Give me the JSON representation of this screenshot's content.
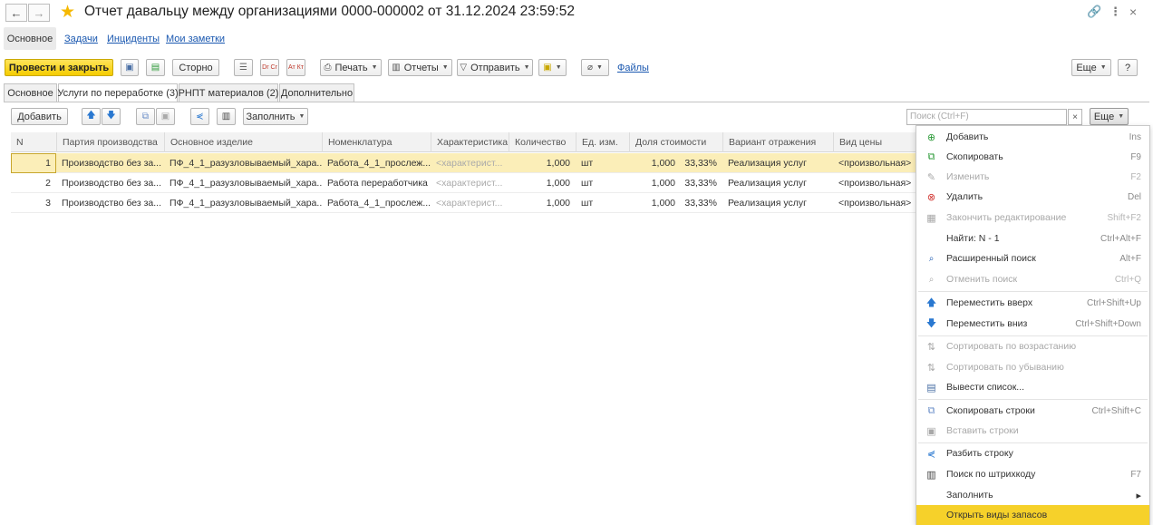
{
  "window": {
    "title": "Отчет давальцу между организациями 0000-000002 от 31.12.2024 23:59:52",
    "back_glyph": "←",
    "forward_glyph": "→",
    "link_glyph": "🔗",
    "more_glyph": "⋮",
    "close_glyph": "×"
  },
  "sections": {
    "active": "Основное",
    "links": [
      "Задачи",
      "Инциденты",
      "Мои заметки"
    ]
  },
  "toolbar": {
    "post_close": "Провести и закрыть",
    "storno": "Сторно",
    "dt_kt": "Dr Cr",
    "at_kt": "Ат Кт",
    "print": "Печать",
    "reports": "Отчеты",
    "send": "Отправить",
    "files": "Файлы",
    "more": "Еще",
    "help": "?"
  },
  "tabs": [
    "Основное",
    "Услуги по переработке (3)",
    "РНПТ материалов (2)",
    "Дополнительно"
  ],
  "table_toolbar": {
    "add": "Добавить",
    "fill": "Заполнить",
    "search_placeholder": "Поиск (Ctrl+F)",
    "search_clear": "×",
    "more": "Еще"
  },
  "table": {
    "columns": [
      "N",
      "Партия производства",
      "Основное изделие",
      "Номенклатура",
      "Характеристика",
      "Количество",
      "Ед. изм.",
      "Доля стоимости",
      "Вариант отражения",
      "Вид цены"
    ],
    "rows": [
      [
        "1",
        "Производство без за...",
        "ПФ_4_1_разузловываемый_хара...",
        "Работа_4_1_прослеж...",
        "<характерист...",
        "1,000",
        "шт",
        "1,000",
        "33,33%",
        "Реализация услуг",
        "<произвольная>"
      ],
      [
        "2",
        "Производство без за...",
        "ПФ_4_1_разузловываемый_хара...",
        "Работа переработчика",
        "<характерист...",
        "1,000",
        "шт",
        "1,000",
        "33,33%",
        "Реализация услуг",
        "<произвольная>"
      ],
      [
        "3",
        "Производство без за...",
        "ПФ_4_1_разузловываемый_хара...",
        "Работа_4_1_прослеж...",
        "<характерист...",
        "1,000",
        "шт",
        "1,000",
        "33,33%",
        "Реализация услуг",
        "<произвольная>"
      ]
    ]
  },
  "menu": {
    "items": [
      {
        "label": "Добавить",
        "shortcut": "Ins",
        "icon": "add-icon",
        "glyph": "⊕",
        "color": "#2e9b3a",
        "disabled": false
      },
      {
        "label": "Скопировать",
        "shortcut": "F9",
        "icon": "copy-icon",
        "glyph": "⧉",
        "color": "#2e9b3a",
        "disabled": false
      },
      {
        "label": "Изменить",
        "shortcut": "F2",
        "icon": "pencil-icon",
        "glyph": "✎",
        "color": "#999",
        "disabled": true
      },
      {
        "label": "Удалить",
        "shortcut": "Del",
        "icon": "delete-icon",
        "glyph": "⊗",
        "color": "#d0312d",
        "disabled": false
      },
      {
        "label": "Закончить редактирование",
        "shortcut": "Shift+F2",
        "icon": "end-edit-icon",
        "glyph": "▦",
        "color": "#aaa",
        "disabled": true
      },
      {
        "label": "Найти: N - 1",
        "shortcut": "Ctrl+Alt+F",
        "icon": "",
        "glyph": "",
        "color": "#333",
        "disabled": false
      },
      {
        "label": "Расширенный поиск",
        "shortcut": "Alt+F",
        "icon": "advanced-search-icon",
        "glyph": "🔍",
        "color": "#1a58b0",
        "disabled": false
      },
      {
        "label": "Отменить поиск",
        "shortcut": "Ctrl+Q",
        "icon": "cancel-search-icon",
        "glyph": "🔍",
        "color": "#aaa",
        "disabled": true
      },
      {
        "label": "Переместить вверх",
        "shortcut": "Ctrl+Shift+Up",
        "icon": "arrow-up-icon",
        "glyph": "🡅",
        "color": "#2a78d0",
        "disabled": false
      },
      {
        "label": "Переместить вниз",
        "shortcut": "Ctrl+Shift+Down",
        "icon": "arrow-down-icon",
        "glyph": "🡇",
        "color": "#2a78d0",
        "disabled": false
      },
      {
        "label": "Сортировать по возрастанию",
        "shortcut": "",
        "icon": "sort-asc-icon",
        "glyph": "⇅",
        "color": "#aaa",
        "disabled": true
      },
      {
        "label": "Сортировать по убыванию",
        "shortcut": "",
        "icon": "sort-desc-icon",
        "glyph": "⇅",
        "color": "#aaa",
        "disabled": true
      },
      {
        "label": "Вывести список...",
        "shortcut": "",
        "icon": "output-list-icon",
        "glyph": "▤",
        "color": "#4a6fa5",
        "disabled": false
      },
      {
        "label": "Скопировать строки",
        "shortcut": "Ctrl+Shift+C",
        "icon": "copy-rows-icon",
        "glyph": "⧉",
        "color": "#6b8fc9",
        "disabled": false
      },
      {
        "label": "Вставить строки",
        "shortcut": "",
        "icon": "paste-rows-icon",
        "glyph": "▣",
        "color": "#aaa",
        "disabled": true
      },
      {
        "label": "Разбить строку",
        "shortcut": "",
        "icon": "split-row-icon",
        "glyph": "⋞",
        "color": "#2a78d0",
        "disabled": false
      },
      {
        "label": "Поиск по штрихкоду",
        "shortcut": "F7",
        "icon": "barcode-icon",
        "glyph": "▥",
        "color": "#444",
        "disabled": false
      },
      {
        "label": "Заполнить",
        "shortcut": "▸",
        "icon": "",
        "glyph": "",
        "color": "#333",
        "disabled": false
      },
      {
        "label": "Открыть виды запасов",
        "shortcut": "",
        "icon": "",
        "glyph": "",
        "color": "#333",
        "disabled": false,
        "highlighted": true
      }
    ]
  },
  "colors": {
    "accent_yellow": "#f5cc00",
    "selection_row": "#fbeeb8",
    "link_blue": "#1a58b0"
  }
}
